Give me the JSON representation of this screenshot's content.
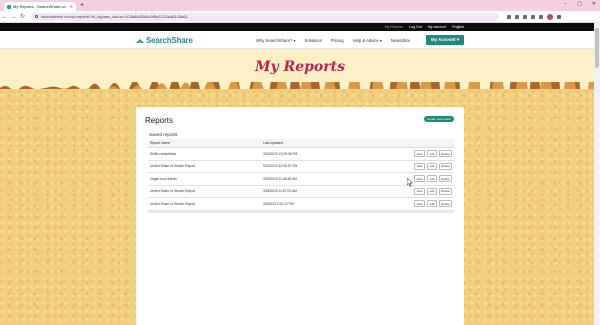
{
  "browser": {
    "tab_title": "My Reports - SearchShare.co",
    "url": "searchshare.co/my-reports/?nl_bypass_cache=103b6b8394fc0f5e1011fcd6145a61",
    "new_tab": "+",
    "minimize": "−",
    "maximize": "▢",
    "close": "✕"
  },
  "utility": {
    "my_reports": "My Reports",
    "logout": "Log Out",
    "my_account": "My account",
    "language": "English"
  },
  "header": {
    "logo": "SearchShare",
    "nav": [
      "Why SearchShare? ▾",
      "Solutions",
      "Pricing",
      "Help & Advice ▾",
      "NewsSlice"
    ],
    "account_button": "My Account ▾"
  },
  "hero": {
    "title": "My Reports"
  },
  "reports": {
    "title": "Reports",
    "create_button": "Create new report",
    "saved_title": "Saved reports",
    "columns": [
      "Report Name",
      "Last updated"
    ],
    "rows": [
      {
        "name": "Shifts competitors",
        "updated": "3/16/2023 12:25:08 PM"
      },
      {
        "name": "United Share of Search Report",
        "updated": "9/22/2022 12:05:37 PM"
      },
      {
        "name": "Vegan food trends",
        "updated": "3/30/2023 11:38:48 AM"
      },
      {
        "name": "United Share of Search Report",
        "updated": "3/28/2023 11:57:02 AM"
      },
      {
        "name": "United Share of Search Report",
        "updated": "3/3/2023 2:51:12 PM"
      }
    ],
    "view_label": "view",
    "edit_label": "edit",
    "delete_label": "Delete"
  },
  "colors": {
    "brand": "#1f8a7a",
    "hero_title": "#c0204a",
    "tabbar": "#f3cfe2"
  }
}
